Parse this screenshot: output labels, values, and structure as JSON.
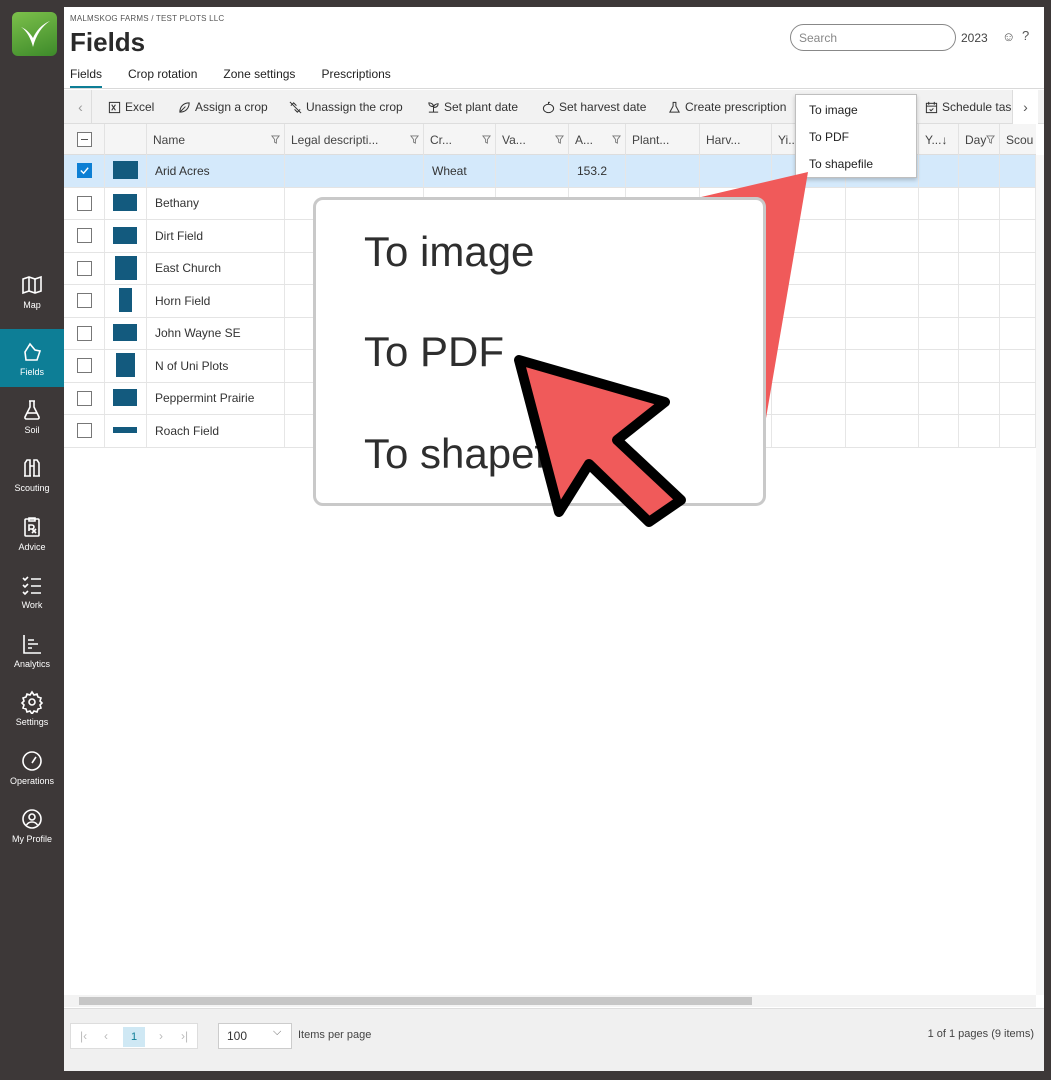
{
  "breadcrumb": "MALMSKOG FARMS / TEST PLOTS LLC",
  "page_title": "Fields",
  "search": {
    "placeholder": "Search"
  },
  "year": "2023",
  "tabs": [
    "Fields",
    "Crop rotation",
    "Zone settings",
    "Prescriptions"
  ],
  "toolbar": {
    "excel": "Excel",
    "assign_crop": "Assign a crop",
    "unassign_crop": "Unassign the crop",
    "set_plant_date": "Set plant date",
    "set_harvest_date": "Set harvest date",
    "create_prescription": "Create prescription",
    "schedule_task": "Schedule task"
  },
  "columns": {
    "name": "Name",
    "legal": "Legal descripti...",
    "crop": "Cr...",
    "variety": "Va...",
    "area": "A...",
    "plant": "Plant...",
    "harvest": "Harv...",
    "yield": "Yi...",
    "y_sort": "Y...↓",
    "day": "Day",
    "scout": "Scou"
  },
  "rows": [
    {
      "name": "Arid Acres",
      "crop": "Wheat",
      "area": "153.2",
      "selected": true
    },
    {
      "name": "Bethany",
      "crop": "",
      "area": "",
      "selected": false
    },
    {
      "name": "Dirt Field",
      "crop": "",
      "area": "",
      "selected": false
    },
    {
      "name": "East Church",
      "crop": "",
      "area": "",
      "selected": false
    },
    {
      "name": "Horn Field",
      "crop": "",
      "area": "",
      "selected": false
    },
    {
      "name": "John Wayne SE",
      "crop": "",
      "area": "",
      "selected": false
    },
    {
      "name": "N of Uni Plots",
      "crop": "",
      "area": "",
      "selected": false
    },
    {
      "name": "Peppermint Prairie",
      "crop": "",
      "area": "",
      "selected": false
    },
    {
      "name": "Roach Field",
      "crop": "",
      "area": "",
      "selected": false
    }
  ],
  "dropdown": {
    "image": "To image",
    "pdf": "To PDF",
    "shapefile": "To shapefile"
  },
  "zoom": {
    "image": "To image",
    "pdf": "To PDF",
    "shapefile": "To shapefile"
  },
  "nav": {
    "map": "Map",
    "fields": "Fields",
    "soil": "Soil",
    "scouting": "Scouting",
    "advice": "Advice",
    "work": "Work",
    "analytics": "Analytics",
    "settings": "Settings",
    "operations": "Operations",
    "profile": "My Profile"
  },
  "pager": {
    "current": "1",
    "page_size": "100",
    "items_per_page": "Items per page",
    "summary": "1 of 1 pages (9 items)"
  },
  "colors": {
    "accent": "#0d7e96",
    "selected_row": "#d4e9fb",
    "shape": "#135a7e",
    "cursor": "#f05a5a"
  }
}
